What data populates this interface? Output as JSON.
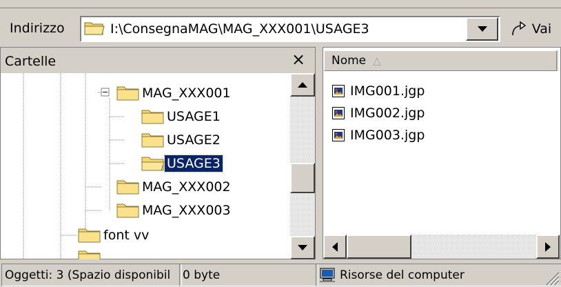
{
  "address_bar": {
    "label": "Indirizzo",
    "path": "I:\\ConsegnaMAG\\MAG_XXX001\\USAGE3",
    "go_label": "Vai"
  },
  "folders_pane": {
    "title": "Cartelle",
    "close": "×",
    "tree": [
      {
        "label": "MAG_XXX001",
        "expanded": true
      },
      {
        "label": "USAGE1"
      },
      {
        "label": "USAGE2"
      },
      {
        "label": "USAGE3",
        "selected": true
      },
      {
        "label": "MAG_XXX002"
      },
      {
        "label": "MAG_XXX003"
      },
      {
        "label": "font vv"
      }
    ]
  },
  "files_pane": {
    "column_name": "Nome",
    "sort_indicator": "△",
    "files": [
      "IMG001.jgp",
      "IMG002.jgp",
      "IMG003.jgp"
    ]
  },
  "status_bar": {
    "objects": "Oggetti: 3 (Spazio disponibil",
    "size": "0 byte",
    "zone": "Risorse del computer"
  },
  "colors": {
    "selection": "#0a246a",
    "folder": "#f5d76e",
    "chrome": "#d4d0c8"
  }
}
